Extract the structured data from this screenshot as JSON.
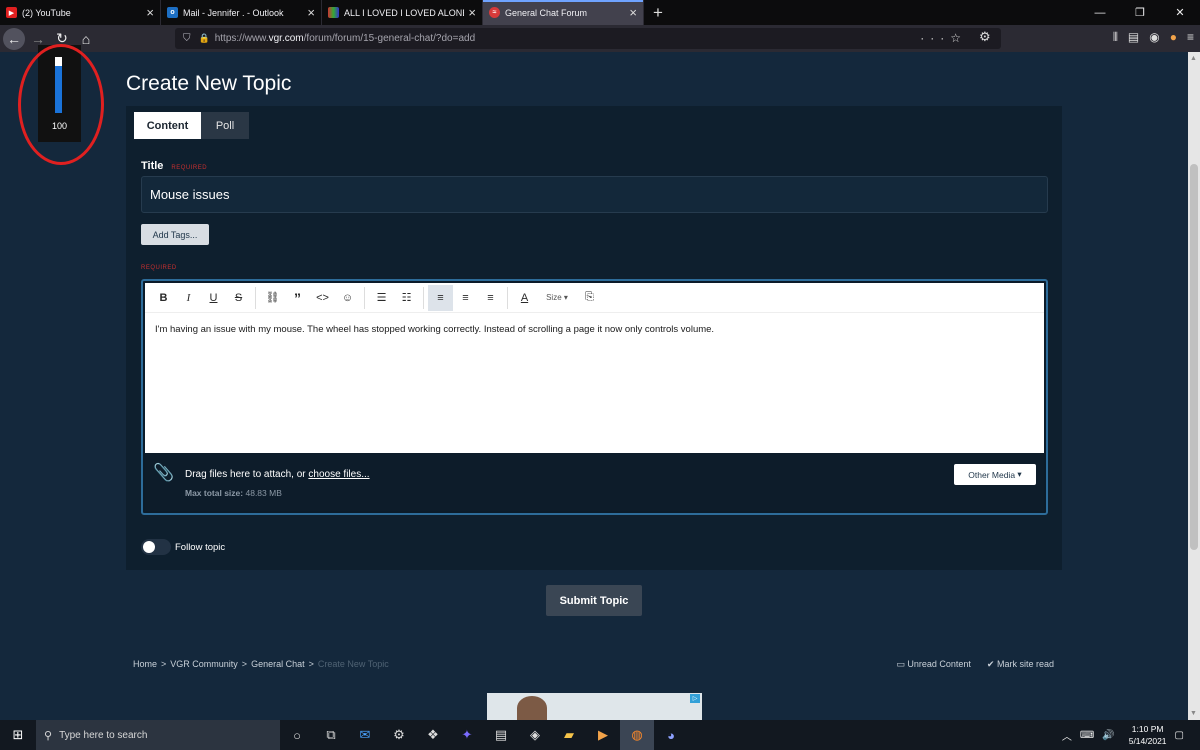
{
  "browser": {
    "tabs": [
      {
        "title": "(2) YouTube",
        "favicon_color": "#e02020",
        "active": false
      },
      {
        "title": "Mail - Jennifer . - Outlook",
        "favicon_color": "#1d6fc4",
        "active": false
      },
      {
        "title": "ALL I LOVED I LOVED ALONE E:",
        "favicon_color": "#6a8d2a",
        "active": false
      },
      {
        "title": "General Chat Forum",
        "favicon_color": "#d63a3a",
        "active": true
      }
    ],
    "new_tab": "+",
    "url_prefix": "https://www.",
    "url_host": "vgr.com",
    "url_path": "/forum/forum/15-general-chat/?do=add"
  },
  "volume_overlay": {
    "value": "100",
    "level": 1.0
  },
  "page": {
    "heading": "Create New Topic",
    "tabs": {
      "content": "Content",
      "poll": "Poll"
    },
    "title_label": "Title",
    "required": "REQUIRED",
    "title_value": "Mouse issues",
    "add_tags": "Add Tags...",
    "editor_required": "REQUIRED",
    "toolbar": {
      "size": "Size"
    },
    "body_text": "I'm having an issue with my mouse. The wheel has stopped working correctly. Instead of scrolling a page it now only controls volume.",
    "attach": {
      "prefix": "Drag files here to attach, or ",
      "link": "choose files...",
      "max_label": "Max total size:",
      "max_value": "48.83 MB",
      "other_media": "Other Media"
    },
    "follow_topic": "Follow topic",
    "submit": "Submit Topic",
    "breadcrumb": [
      "Home",
      "VGR Community",
      "General Chat",
      "Create New Topic"
    ],
    "breadcrumb_sep": ">",
    "unread": "Unread Content",
    "mark_read": "Mark site read"
  },
  "taskbar": {
    "search_placeholder": "Type here to search",
    "time": "1:10 PM",
    "date": "5/14/2021"
  },
  "colors": {
    "page_bg": "#14283c",
    "panel_bg": "#0e1f2e",
    "accent": "#2d6c9a",
    "required": "#c62f2f",
    "annotation_circle": "#e02020"
  }
}
